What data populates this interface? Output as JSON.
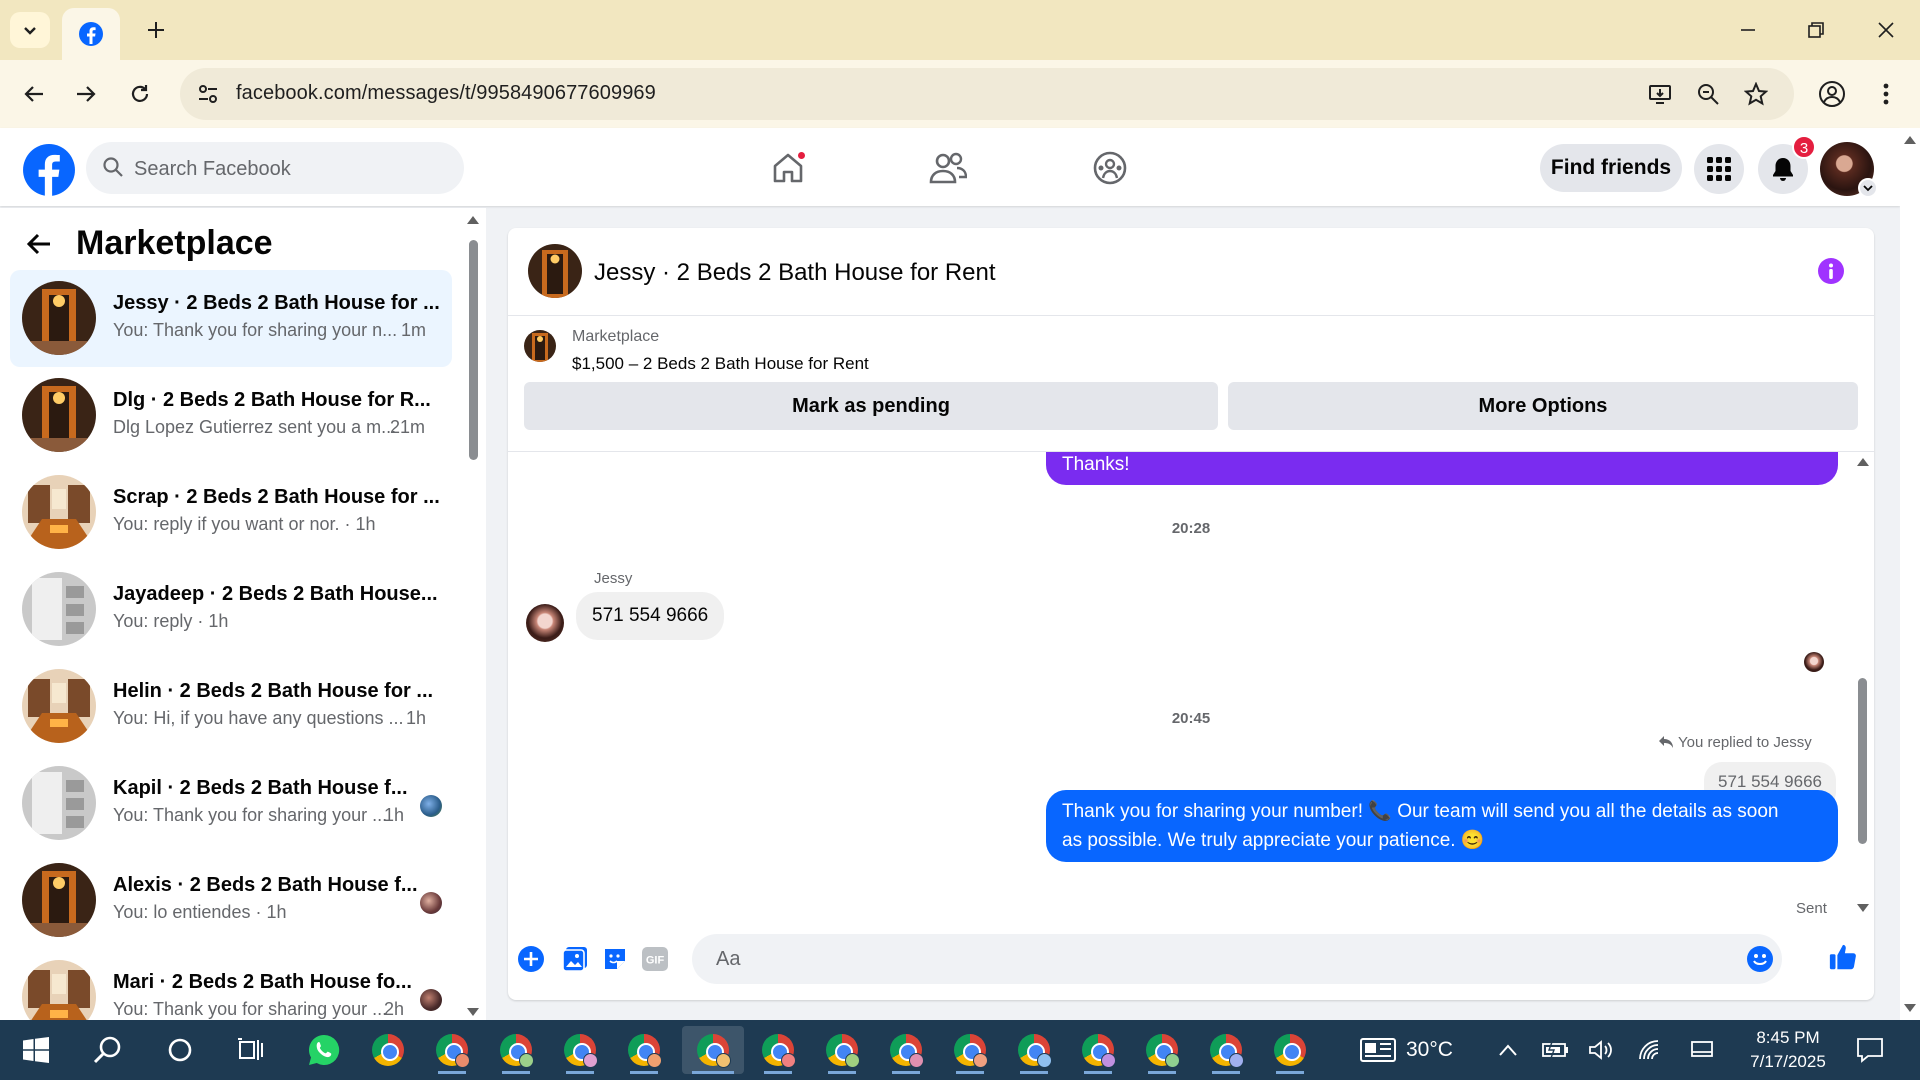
{
  "browser": {
    "url": "facebook.com/messages/t/9958490677609969"
  },
  "header": {
    "search_placeholder": "Search Facebook",
    "find_friends": "Find friends",
    "notifications_count": "3"
  },
  "sidebar": {
    "title": "Marketplace",
    "conversations": [
      {
        "name": "Jessy · 2 Beds 2 Bath House for ...",
        "snippet": "You: Thank you for sharing your n...",
        "time": "1m",
        "thumb": "photo-orange"
      },
      {
        "name": "Dlg · 2 Beds 2 Bath House for R...",
        "snippet": "Dlg Lopez Gutierrez sent you a m...",
        "time": "21m",
        "thumb": "photo-orange"
      },
      {
        "name": "Scrap · 2 Beds 2 Bath House for ...",
        "snippet": "You: reply if you want or nor. · 1h",
        "time": "",
        "thumb": "photo-room"
      },
      {
        "name": "Jayadeep · 2 Beds 2 Bath House...",
        "snippet": "You: reply · 1h",
        "time": "",
        "thumb": "photo-grey"
      },
      {
        "name": "Helin · 2 Beds 2 Bath House for ...",
        "snippet": "You: Hi, if you have any questions ...",
        "time": "1h",
        "thumb": "photo-room"
      },
      {
        "name": "Kapil · 2 Beds 2 Bath House f...",
        "snippet": "You: Thank you for sharing your ...",
        "time": "1h",
        "thumb": "photo-grey"
      },
      {
        "name": "Alexis · 2 Beds 2 Bath House f...",
        "snippet": "You: lo entiendes · 1h",
        "time": "",
        "thumb": "photo-orange"
      },
      {
        "name": "Mari · 2 Beds 2 Bath House fo...",
        "snippet": "You: Thank you for sharing your ...",
        "time": "2h",
        "thumb": "photo-room"
      }
    ]
  },
  "chat": {
    "title": "Jessy · 2 Beds 2 Bath House for Rent",
    "listing_label": "Marketplace",
    "listing_price": "$1,500 – 2 Beds 2 Bath House for Rent",
    "mark_pending": "Mark as pending",
    "more_options": "More Options",
    "messages": {
      "prev_out": "Thanks!",
      "time1": "20:28",
      "sender_name": "Jessy",
      "incoming": "571 554 9666",
      "time2": "20:45",
      "replied_to": "You replied to Jessy",
      "quoted": "571 554 9666",
      "outgoing_line1": "Thank you for sharing your number! 📞 Our team will send you all the details as soon",
      "outgoing_line2": "as possible. We truly appreciate your patience. 😊",
      "status": "Sent"
    },
    "composer_placeholder": "Aa"
  },
  "taskbar": {
    "weather": "30°C",
    "time": "8:45 PM",
    "date": "7/17/2025"
  },
  "colors": {
    "fb_blue": "#0866ff",
    "purple_bubble": "#7a2cf0",
    "notification_red": "#e41e3f"
  }
}
